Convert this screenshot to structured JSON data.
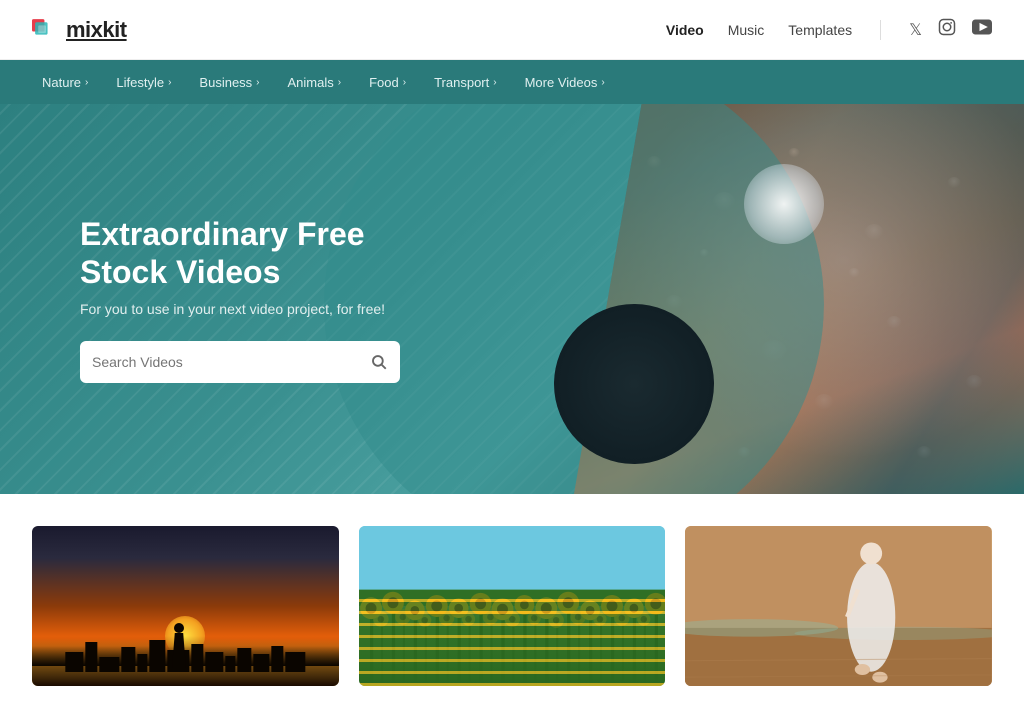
{
  "logo": {
    "text": "mixkit",
    "aria": "Mixkit home"
  },
  "topnav": {
    "links": [
      {
        "label": "Video",
        "active": true
      },
      {
        "label": "Music",
        "active": false
      },
      {
        "label": "Templates",
        "active": false
      }
    ],
    "social": [
      {
        "name": "twitter",
        "symbol": "𝕏"
      },
      {
        "name": "instagram",
        "symbol": "□"
      },
      {
        "name": "youtube",
        "symbol": "▶"
      }
    ]
  },
  "categories": [
    {
      "label": "Nature",
      "has_chevron": true
    },
    {
      "label": "Lifestyle",
      "has_chevron": true
    },
    {
      "label": "Business",
      "has_chevron": true
    },
    {
      "label": "Animals",
      "has_chevron": true
    },
    {
      "label": "Food",
      "has_chevron": true
    },
    {
      "label": "Transport",
      "has_chevron": true
    },
    {
      "label": "More Videos",
      "has_chevron": true
    }
  ],
  "hero": {
    "title": "Extraordinary Free Stock Videos",
    "subtitle": "For you to use in your next video project, for free!",
    "search_placeholder": "Search Videos"
  },
  "videos": [
    {
      "id": "sunset",
      "alt": "Woman silhouette at sunset"
    },
    {
      "id": "sunflower",
      "alt": "Sunflower field"
    },
    {
      "id": "beach",
      "alt": "Person walking on beach"
    }
  ]
}
